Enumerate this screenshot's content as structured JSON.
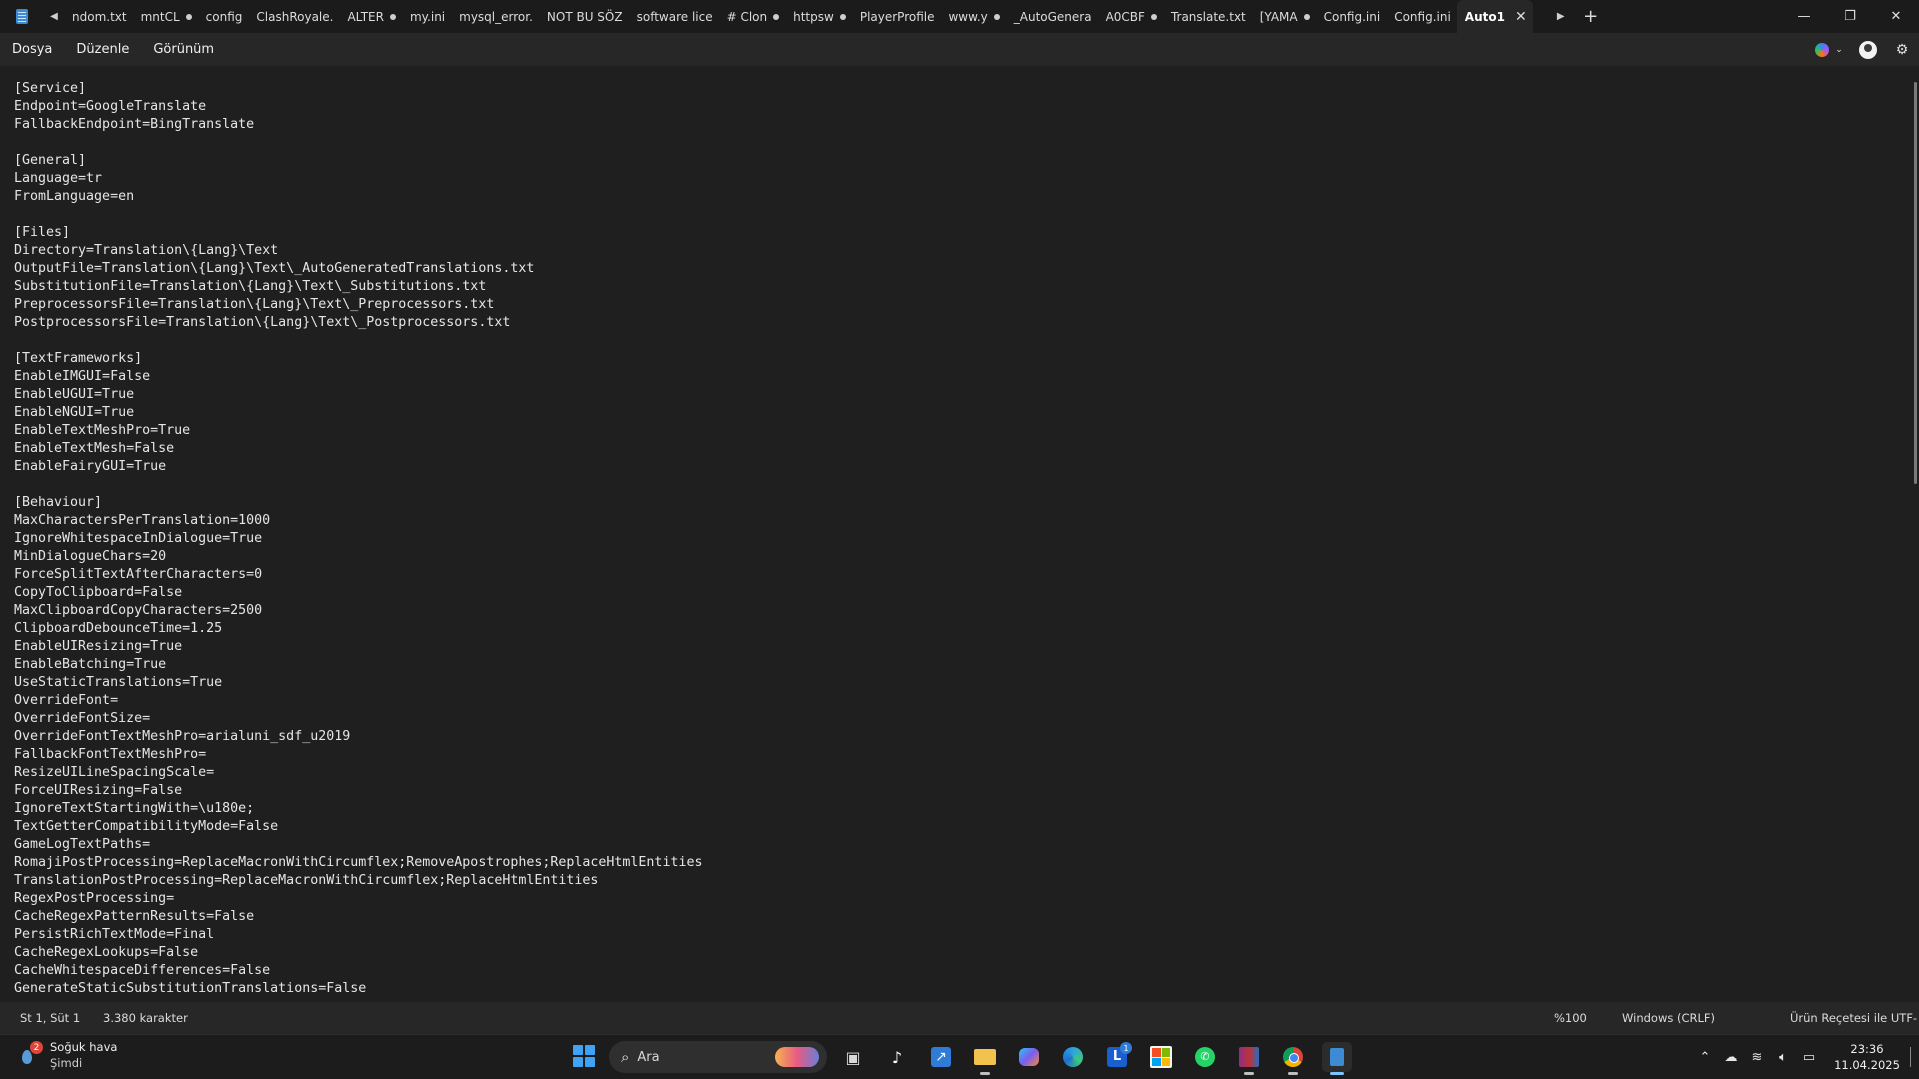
{
  "tabs": [
    {
      "label": "ndom.txt",
      "modified": false
    },
    {
      "label": "mntCL",
      "modified": true
    },
    {
      "label": "config",
      "modified": false
    },
    {
      "label": "ClashRoyale.",
      "modified": false
    },
    {
      "label": "ALTER",
      "modified": true
    },
    {
      "label": "my.ini",
      "modified": false
    },
    {
      "label": "mysql_error.",
      "modified": false
    },
    {
      "label": "NOT BU SÖZ",
      "modified": false
    },
    {
      "label": "software lice",
      "modified": false
    },
    {
      "label": "# Clon",
      "modified": true
    },
    {
      "label": "httpsw",
      "modified": true
    },
    {
      "label": "PlayerProfile",
      "modified": false
    },
    {
      "label": "www.y",
      "modified": true
    },
    {
      "label": "_AutoGenera",
      "modified": false
    },
    {
      "label": "A0CBF",
      "modified": true
    },
    {
      "label": "Translate.txt",
      "modified": false
    },
    {
      "label": "[YAMA",
      "modified": true
    },
    {
      "label": "Config.ini",
      "modified": false
    },
    {
      "label": "Config.ini",
      "modified": false
    }
  ],
  "active_tab": {
    "label": "Auto1"
  },
  "menu": {
    "file": "Dosya",
    "edit": "Düzenle",
    "view": "Görünüm"
  },
  "editor": {
    "text": "[Service]\nEndpoint=GoogleTranslate\nFallbackEndpoint=BingTranslate\n\n[General]\nLanguage=tr\nFromLanguage=en\n\n[Files]\nDirectory=Translation\\{Lang}\\Text\nOutputFile=Translation\\{Lang}\\Text\\_AutoGeneratedTranslations.txt\nSubstitutionFile=Translation\\{Lang}\\Text\\_Substitutions.txt\nPreprocessorsFile=Translation\\{Lang}\\Text\\_Preprocessors.txt\nPostprocessorsFile=Translation\\{Lang}\\Text\\_Postprocessors.txt\n\n[TextFrameworks]\nEnableIMGUI=False\nEnableUGUI=True\nEnableNGUI=True\nEnableTextMeshPro=True\nEnableTextMesh=False\nEnableFairyGUI=True\n\n[Behaviour]\nMaxCharactersPerTranslation=1000\nIgnoreWhitespaceInDialogue=True\nMinDialogueChars=20\nForceSplitTextAfterCharacters=0\nCopyToClipboard=False\nMaxClipboardCopyCharacters=2500\nClipboardDebounceTime=1.25\nEnableUIResizing=True\nEnableBatching=True\nUseStaticTranslations=True\nOverrideFont=\nOverrideFontSize=\nOverrideFontTextMeshPro=arialuni_sdf_u2019\nFallbackFontTextMeshPro=\nResizeUILineSpacingScale=\nForceUIResizing=False\nIgnoreTextStartingWith=\\u180e;\nTextGetterCompatibilityMode=False\nGameLogTextPaths=\nRomajiPostProcessing=ReplaceMacronWithCircumflex;RemoveApostrophes;ReplaceHtmlEntities\nTranslationPostProcessing=ReplaceMacronWithCircumflex;ReplaceHtmlEntities\nRegexPostProcessing=\nCacheRegexPatternResults=False\nPersistRichTextMode=Final\nCacheRegexLookups=False\nCacheWhitespaceDifferences=False\nGenerateStaticSubstitutionTranslations=False"
  },
  "status": {
    "position": "St 1, Süt 1",
    "chars": "3.380 karakter",
    "zoom": "%100",
    "line_ending": "Windows (CRLF)",
    "encoding": "Ürün Reçetesi ile UTF-"
  },
  "taskbar": {
    "weather_title": "Soğuk hava",
    "weather_sub": "Şimdi",
    "weather_badge": "2",
    "search_placeholder": "Ara",
    "notify_badge": "1",
    "time": "23:36",
    "date": "11.04.2025"
  },
  "colors": {
    "accent": "#3c8bd4",
    "editor_bg": "#1f1f1f",
    "bar_bg": "#272727"
  }
}
